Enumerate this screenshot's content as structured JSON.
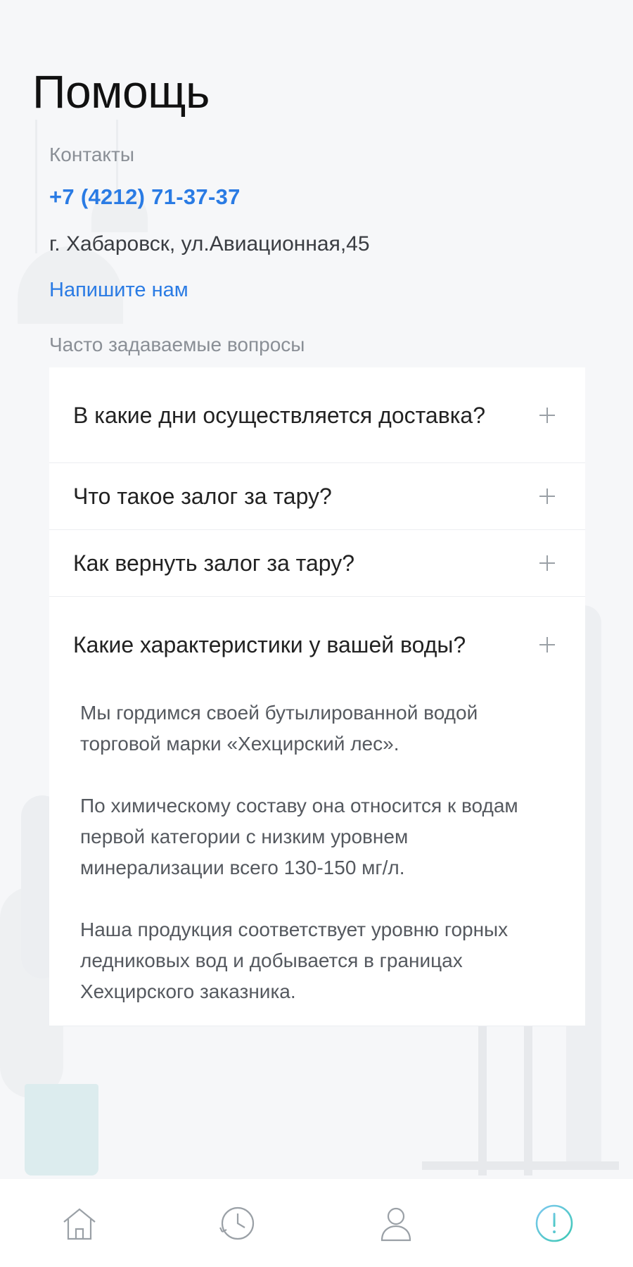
{
  "page": {
    "title": "Помощь"
  },
  "contacts": {
    "label": "Контакты",
    "phone": "+7 (4212) 71-37-37",
    "address": "г. Хабаровск, ул.Авиационная,45",
    "write_us": "Напишите нам"
  },
  "faq": {
    "label": "Часто задаваемые вопросы",
    "items": [
      {
        "question": "В какие дни осуществляется доставка?"
      },
      {
        "question": "Что такое залог за тару?"
      },
      {
        "question": "Как вернуть залог за тару?"
      },
      {
        "question": "Какие характеристики у вашей воды?",
        "answer": [
          "Мы гордимся своей бутылированной водой торговой марки «Хехцирский лес».",
          "По химическому составу она относится к водам первой категории с низким уровнем минерализации всего 130-150 мг/л.",
          "Наша продукция соответствует уровню горных ледниковых вод и добывается в границах Хехцирского заказника."
        ]
      }
    ]
  },
  "tabbar": {
    "items": [
      {
        "icon": "home-icon",
        "active": false
      },
      {
        "icon": "history-icon",
        "active": false
      },
      {
        "icon": "profile-icon",
        "active": false
      },
      {
        "icon": "help-icon",
        "active": true
      }
    ]
  },
  "colors": {
    "accent": "#2a7be4",
    "active_tab": "#3cc8b4"
  }
}
